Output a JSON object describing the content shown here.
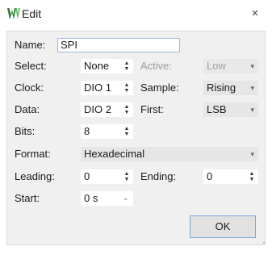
{
  "window": {
    "title": "Edit",
    "close_glyph": "×",
    "app_icon": "w-logo-icon",
    "accent": "#2e7d32"
  },
  "form": {
    "name": {
      "label": "Name:",
      "value": "SPI"
    },
    "select": {
      "label": "Select:",
      "value": "None"
    },
    "active": {
      "label": "Active:",
      "value": "Low"
    },
    "clock": {
      "label": "Clock:",
      "value": "DIO 1"
    },
    "sample": {
      "label": "Sample:",
      "value": "Rising"
    },
    "data": {
      "label": "Data:",
      "value": "DIO 2"
    },
    "first": {
      "label": "First:",
      "value": "LSB"
    },
    "bits": {
      "label": "Bits:",
      "value": "8"
    },
    "format": {
      "label": "Format:",
      "value": "Hexadecimal"
    },
    "leading": {
      "label": "Leading:",
      "value": "0"
    },
    "ending": {
      "label": "Ending:",
      "value": "0"
    },
    "start": {
      "label": "Start:",
      "value": "0 s"
    }
  },
  "buttons": {
    "ok": "OK"
  },
  "glyphs": {
    "spin_up": "▲",
    "spin_down": "▼",
    "dropdown": "▾",
    "combo_arrow": "⌄"
  }
}
